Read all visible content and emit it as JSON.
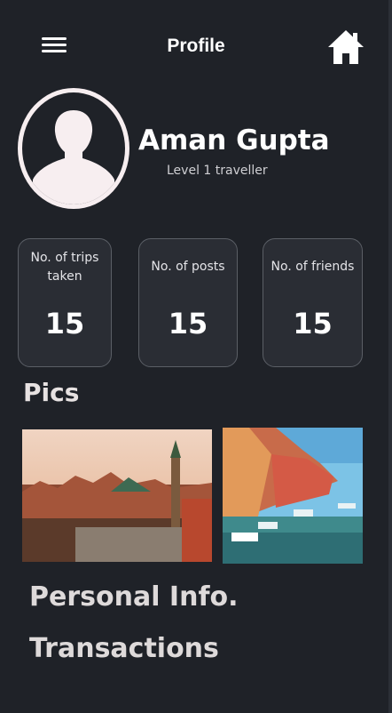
{
  "header": {
    "title": "Profile",
    "menu_icon": "hamburger-menu-icon",
    "home_icon": "home-icon"
  },
  "profile": {
    "name": "Aman Gupta",
    "level": "Level 1 traveller",
    "avatar_icon": "user-silhouette-icon"
  },
  "stats": [
    {
      "label_line1": "No. of trips",
      "label_line2": "taken",
      "value": "15"
    },
    {
      "label_line1": "No. of posts",
      "label_line2": "",
      "value": "15"
    },
    {
      "label_line1": "No. of friends",
      "label_line2": "",
      "value": "15"
    }
  ],
  "pics": {
    "title": "Pics",
    "items": [
      {
        "subject": "old-town-city-skyline-photo"
      },
      {
        "subject": "canal-with-boats-photo"
      }
    ]
  },
  "links": {
    "personal_info": "Personal Info.",
    "transactions": "Transactions"
  },
  "colors": {
    "background": "#1f2228",
    "card_border": "#5b5f66",
    "text": "#ffffff"
  }
}
